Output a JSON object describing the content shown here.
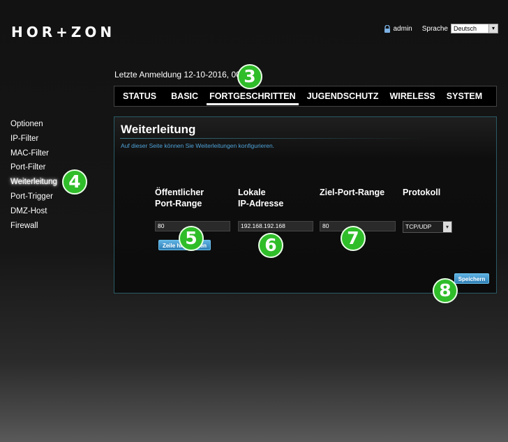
{
  "brand": {
    "logo": "HOR+ZON"
  },
  "header": {
    "user": "admin",
    "lang_label": "Sprache",
    "lang_value": "Deutsch",
    "last_login": "Letzte Anmeldung 12-10-2016, 00:2"
  },
  "tabs": [
    {
      "label": "STATUS"
    },
    {
      "label": "BASIC"
    },
    {
      "label": "FORTGESCHRITTEN"
    },
    {
      "label": "JUGENDSCHUTZ"
    },
    {
      "label": "WIRELESS"
    },
    {
      "label": "SYSTEM"
    }
  ],
  "sidebar": {
    "items": [
      {
        "label": "Optionen"
      },
      {
        "label": "IP-Filter"
      },
      {
        "label": "MAC-Filter"
      },
      {
        "label": "Port-Filter"
      },
      {
        "label": "Weiterleitung"
      },
      {
        "label": "Port-Trigger"
      },
      {
        "label": "DMZ-Host"
      },
      {
        "label": "Firewall"
      }
    ]
  },
  "panel": {
    "title": "Weiterleitung",
    "description": "Auf dieser Seite können Sie Weiterleitungen konfigurieren.",
    "columns": {
      "public_line1": "Öffentlicher",
      "public_line2": "Port-Range",
      "local_line1": "Lokale",
      "local_line2": "IP-Adresse",
      "target": "Ziel-Port-Range",
      "protocol": "Protokoll"
    },
    "row": {
      "public_port": "80",
      "local_ip": "192.168.192.168",
      "target_port": "80",
      "protocol": "TCP/UDP"
    },
    "add_row_button": "Zeile hinzufügen",
    "save_button": "Speichern"
  },
  "badges": [
    "3",
    "4",
    "5",
    "6",
    "7",
    "8"
  ],
  "colors": {
    "badge": "#2fbd2a",
    "button": "#3a8fc6",
    "accent_text": "#4fa3d8"
  },
  "icons": {
    "user": "lock-icon"
  }
}
